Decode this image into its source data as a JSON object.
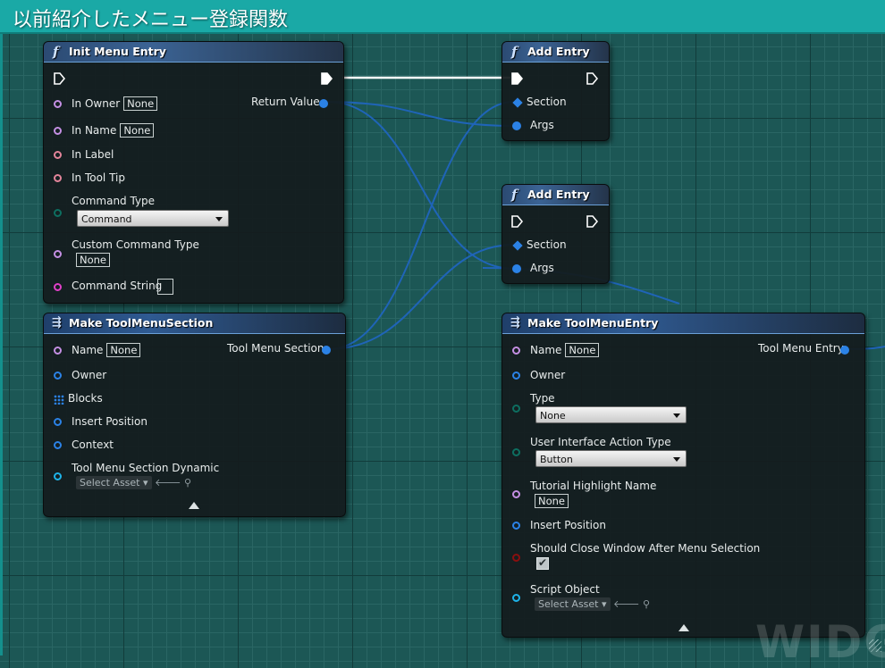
{
  "comment": {
    "title": "以前紹介したメニュー登録関数"
  },
  "colors": {
    "grid_bg": "#1c5755",
    "comment": "#1aa9a6",
    "struct_pin": "#2b82e6",
    "object_pin": "#c48fe3",
    "text_pin": "#e2849a",
    "name_pin": "#c48fe3",
    "string_pin": "#e040c8",
    "byte_pin": "#0d6e60",
    "bool_pin": "#8a0f0f",
    "interface_pin": "#1eb3e8"
  },
  "nodes": {
    "init_menu_entry": {
      "title": "Init Menu Entry",
      "icon": "function-icon",
      "in_owner": {
        "label": "In Owner",
        "value": "None"
      },
      "in_name": {
        "label": "In Name",
        "value": "None"
      },
      "in_label": {
        "label": "In Label"
      },
      "in_tool_tip": {
        "label": "In Tool Tip"
      },
      "command_type": {
        "label": "Command Type",
        "value": "Command"
      },
      "custom_command_type": {
        "label": "Custom Command Type",
        "value": "None"
      },
      "command_string": {
        "label": "Command String",
        "value": ""
      },
      "return_value": {
        "label": "Return Value"
      }
    },
    "add_entry_1": {
      "title": "Add Entry",
      "icon": "function-icon",
      "section": "Section",
      "args": "Args"
    },
    "add_entry_2": {
      "title": "Add Entry",
      "icon": "function-icon",
      "section": "Section",
      "args": "Args"
    },
    "make_tool_menu_section": {
      "title": "Make ToolMenuSection",
      "icon": "make-struct-icon",
      "name": {
        "label": "Name",
        "value": "None"
      },
      "owner": "Owner",
      "blocks": "Blocks",
      "insert_position": "Insert Position",
      "context": "Context",
      "dynamic": {
        "label": "Tool Menu Section Dynamic",
        "value": "Select Asset"
      },
      "output": "Tool Menu Section"
    },
    "make_tool_menu_entry": {
      "title": "Make ToolMenuEntry",
      "icon": "make-struct-icon",
      "name": {
        "label": "Name",
        "value": "None"
      },
      "owner": "Owner",
      "type": {
        "label": "Type",
        "value": "None"
      },
      "ui_action_type": {
        "label": "User Interface Action Type",
        "value": "Button"
      },
      "tutorial": {
        "label": "Tutorial Highlight Name",
        "value": "None"
      },
      "insert_position": "Insert Position",
      "should_close": {
        "label": "Should Close Window After Menu Selection",
        "checked": true
      },
      "script_object": {
        "label": "Script Object",
        "value": "Select Asset"
      },
      "output": "Tool Menu Entry"
    }
  },
  "watermark": "WIDG"
}
